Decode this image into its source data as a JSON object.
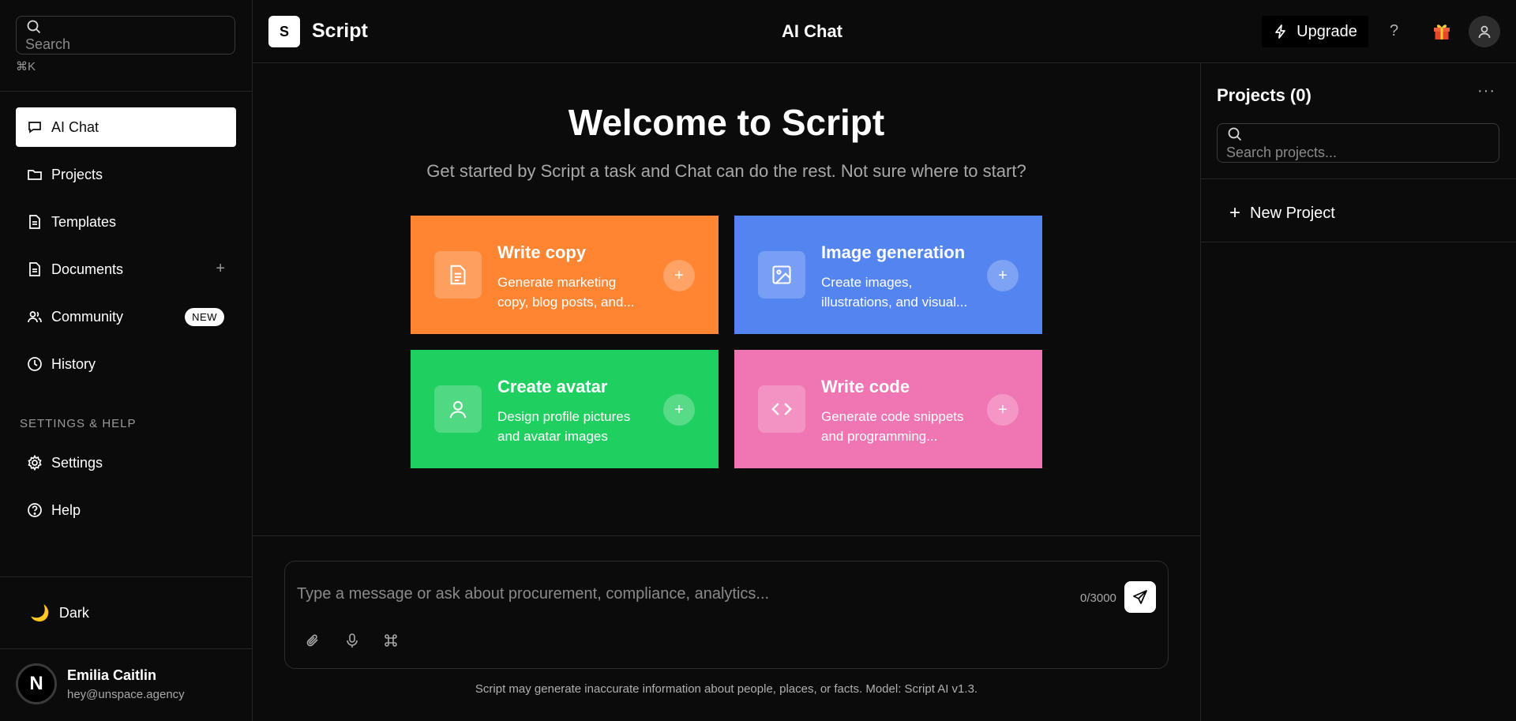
{
  "sidebar": {
    "search_placeholder": "Search",
    "search_shortcut": "⌘K",
    "nav": [
      {
        "label": "AI Chat"
      },
      {
        "label": "Projects"
      },
      {
        "label": "Templates"
      },
      {
        "label": "Documents"
      },
      {
        "label": "Community",
        "badge": "NEW"
      },
      {
        "label": "History"
      }
    ],
    "section_label": "SETTINGS & HELP",
    "settings_nav": [
      {
        "label": "Settings"
      },
      {
        "label": "Help"
      }
    ],
    "theme_label": "Dark",
    "user": {
      "initial": "N",
      "name": "Emilia Caitlin",
      "email": "hey@unspace.agency"
    }
  },
  "topbar": {
    "logo_letter": "S",
    "app_title": "Script",
    "page_title": "AI Chat",
    "upgrade_label": "Upgrade",
    "help_label": "?"
  },
  "main": {
    "welcome": "Welcome to Script",
    "subtitle": "Get started by Script a task and Chat can do the rest. Not sure where to start?",
    "cards": [
      {
        "title": "Write copy",
        "desc": "Generate marketing copy, blog posts, and...",
        "color": "#ff8533",
        "icon": "document-icon"
      },
      {
        "title": "Image generation",
        "desc": "Create images, illustrations, and visual...",
        "color": "#5384f0",
        "icon": "image-icon"
      },
      {
        "title": "Create avatar",
        "desc": "Design profile pictures and avatar images",
        "color": "#1fcf5f",
        "icon": "user-icon"
      },
      {
        "title": "Write code",
        "desc": "Generate code snippets and programming...",
        "color": "#f075b3",
        "icon": "code-icon"
      }
    ],
    "composer": {
      "placeholder": "Type a message or ask about procurement, compliance, analytics...",
      "char_count": "0/3000"
    },
    "disclaimer": "Script may generate inaccurate information about people, places, or facts. Model: Script AI v1.3."
  },
  "projects": {
    "title": "Projects (0)",
    "more_label": "···",
    "search_placeholder": "Search projects...",
    "new_project_label": "New Project"
  }
}
